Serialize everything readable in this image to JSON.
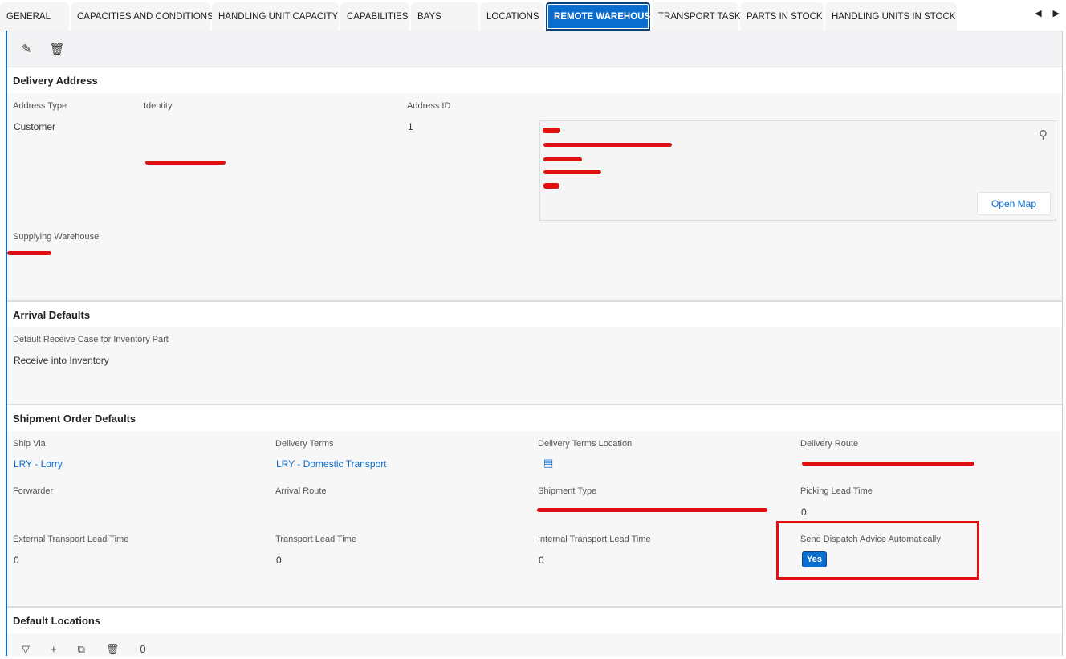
{
  "tabs": [
    "GENERAL",
    "CAPACITIES AND CONDITIONS",
    "HANDLING UNIT CAPACITY",
    "CAPABILITIES",
    "BAYS",
    "LOCATIONS",
    "REMOTE WAREHOUSE",
    "TRANSPORT TASK",
    "PARTS IN STOCK",
    "HANDLING UNITS IN STOCK"
  ],
  "active_tab": "REMOTE WAREHOUSE",
  "delivery": {
    "title": "Delivery Address",
    "address_type_label": "Address Type",
    "address_type": "Customer",
    "identity_label": "Identity",
    "address_id_label": "Address ID",
    "address_id": "1",
    "open_map": "Open Map",
    "supplying_warehouse_label": "Supplying Warehouse"
  },
  "arrival": {
    "title": "Arrival Defaults",
    "receive_case_label": "Default Receive Case for Inventory Part",
    "receive_case": "Receive into Inventory"
  },
  "shipment": {
    "title": "Shipment Order Defaults",
    "ship_via_label": "Ship Via",
    "ship_via": "LRY - Lorry",
    "delivery_terms_label": "Delivery Terms",
    "delivery_terms": "LRY - Domestic Transport",
    "dtl_label": "Delivery Terms Location",
    "route_label": "Delivery Route",
    "forwarder_label": "Forwarder",
    "arrival_route_label": "Arrival Route",
    "shipment_type_label": "Shipment Type",
    "picking_label": "Picking Lead Time",
    "picking": "0",
    "ext_label": "External Transport Lead Time",
    "ext": "0",
    "tlt_label": "Transport Lead Time",
    "tlt": "0",
    "int_label": "Internal Transport Lead Time",
    "int": "0",
    "sda_label": "Send Dispatch Advice Automatically",
    "sda": "Yes"
  },
  "locations": {
    "title": "Default Locations",
    "count": "0"
  }
}
